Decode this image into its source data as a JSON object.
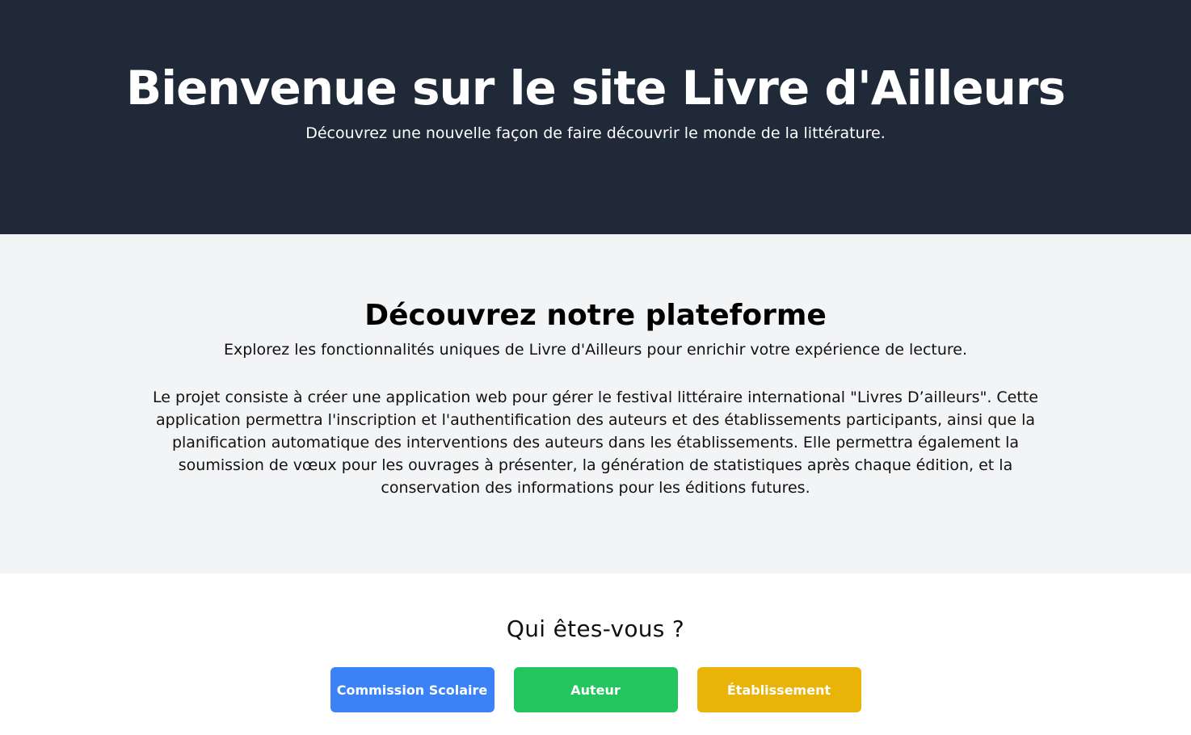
{
  "hero": {
    "title": "Bienvenue sur le site Livre d'Ailleurs",
    "subtitle": "Découvrez une nouvelle façon de faire découvrir le monde de la littérature."
  },
  "platform": {
    "title": "Découvrez notre plateforme",
    "lead": "Explorez les fonctionnalités uniques de Livre d'Ailleurs pour enrichir votre expérience de lecture.",
    "description": "Le projet consiste à créer une application web pour gérer le festival littéraire international \"Livres D’ailleurs\". Cette application permettra l'inscription et l'authentification des auteurs et des établissements participants, ainsi que la planification automatique des interventions des auteurs dans les établissements. Elle permettra également la soumission de vœux pour les ouvrages à présenter, la génération de statistiques après chaque édition, et la conservation des informations pour les éditions futures."
  },
  "role_selection": {
    "title": "Qui êtes-vous ?",
    "buttons": [
      {
        "label": "Commission Scolaire",
        "color": "#3b82f6"
      },
      {
        "label": "Auteur",
        "color": "#22c55e"
      },
      {
        "label": "Établissement",
        "color": "#eab308"
      }
    ]
  },
  "colors": {
    "hero_background": "#1f2937",
    "platform_background": "#f3f4f6",
    "role_background": "#ffffff"
  }
}
